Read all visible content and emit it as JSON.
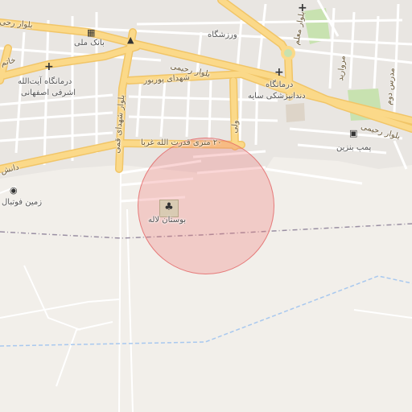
{
  "map": {
    "places": {
      "bank_melli": "بانک ملی",
      "varzeshgah": "ورزشگاه",
      "clinic_ashrafi_1": "درمانگاه آیت‌الله",
      "clinic_ashrafi_2": "اشرفی اصفهانی",
      "dental_1": "درمانگاه",
      "dental_2": "دندانپزشکی سایه",
      "gas_station": "پمپ بنزین",
      "football": "زمین فوتبال",
      "park": "بوستان لاله"
    },
    "roads": {
      "blvd_rahimi_top": "بلوار رحیمی",
      "blvd_rahimi_mid": "بلوار رحیمی",
      "blvd_rahimi_right": "بلوار رحیمی",
      "shohada_pourbor": "شهدای پوربور",
      "shahid_ghomi": "بلوار شهدای قمی",
      "ghodrat": "۲۰ متری قدرت الله غربا",
      "blvd_moallem": "بلوار معلم",
      "daneshgah": "دانش",
      "morvarid": "مروارید",
      "madras": "مدرس دوم",
      "right_vert": "ولی",
      "top_left": "بلوار رحی",
      "khatam": "خاتم"
    },
    "icons": {
      "bank": "bank-icon",
      "shop": "shop-icon",
      "hospital": "hospital-icon",
      "fuel": "fuel-icon",
      "stadium": "stadium-icon",
      "park": "park-icon"
    },
    "colors": {
      "background": "#f2efea",
      "major_road": "#fbd989",
      "minor_road": "#ffffff",
      "green": "#c8e2b0",
      "highlight_fill": "#f07878",
      "boundary": "#9a8fa3",
      "water": "#a8c8ef"
    }
  }
}
